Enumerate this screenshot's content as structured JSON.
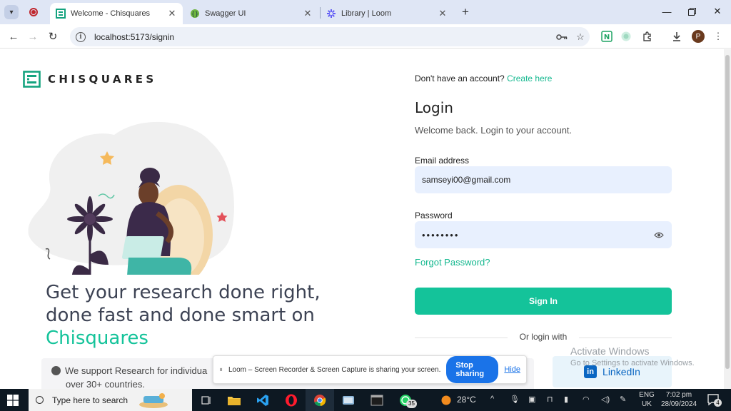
{
  "browser": {
    "tabs": [
      {
        "title": "Welcome - Chisquares",
        "icon": "chisquares-favicon"
      },
      {
        "title": "Swagger UI",
        "icon": "swagger-favicon"
      },
      {
        "title": "Library | Loom",
        "icon": "loom-favicon"
      }
    ],
    "url": "localhost:5173/signin"
  },
  "brand": {
    "name": "CHISQUARES",
    "accent_color": "#14c39a"
  },
  "hero": {
    "line1": "Get your research done right,",
    "line2": "done fast and done smart on",
    "brand": "Chisquares"
  },
  "support": {
    "line1": "We support Research for individua",
    "line2": "over 30+ countries."
  },
  "auth": {
    "signup_prompt": "Don't have an account?",
    "signup_link": "Create here",
    "title": "Login",
    "subtitle": "Welcome back. Login to your account.",
    "email_label": "Email address",
    "email_value": "samseyi00@gmail.com",
    "password_label": "Password",
    "password_value": "••••••••",
    "forgot": "Forgot Password?",
    "signin_button": "Sign In",
    "or_text": "Or login with",
    "linkedin": "LinkedIn"
  },
  "activation": {
    "title": "Activate Windows",
    "subtitle": "Go to Settings to activate Windows."
  },
  "loom_bar": {
    "message": "Loom – Screen Recorder & Screen Capture is sharing your screen.",
    "stop": "Stop sharing",
    "hide": "Hide"
  },
  "taskbar": {
    "search_placeholder": "Type here to search",
    "chrome_badge": "35",
    "temperature": "28°C",
    "language": "ENG",
    "region": "UK",
    "time": "7:02 pm",
    "date": "28/09/2024"
  }
}
